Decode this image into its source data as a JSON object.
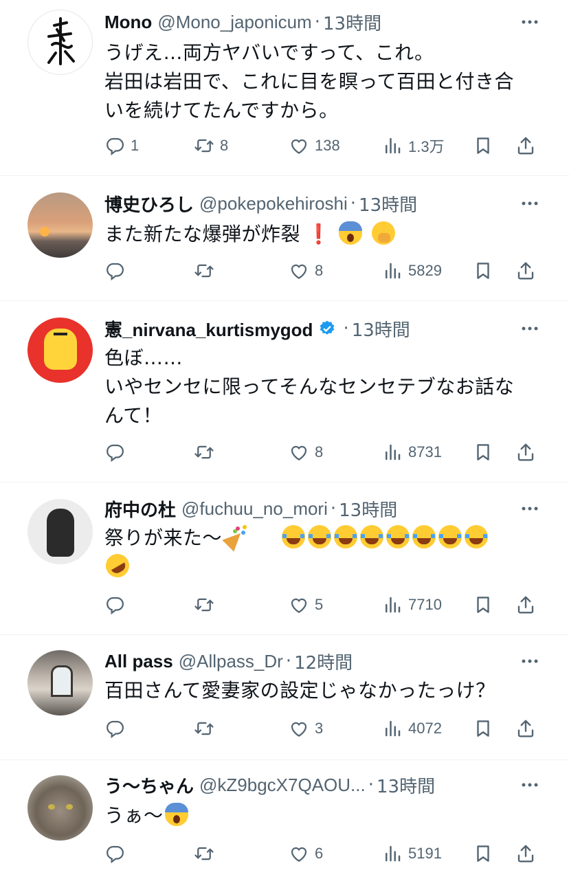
{
  "tweets": [
    {
      "name": "Mono",
      "handle": "@Mono_japonicum",
      "time": "13時間",
      "lines": [
        "うげえ…両方ヤバいですって、これ。",
        "岩田は岩田で、これに目を瞑って百田と付き合",
        "いを続けてたんですから。"
      ],
      "replies": "1",
      "retweets": "8",
      "likes": "138",
      "views": "1.3万",
      "avatar": "brush-calligraphy"
    },
    {
      "name": "博史ひろし",
      "handle": "@pokepokehiroshi",
      "time": "13時間",
      "line1": "また新たな爆弾が炸裂",
      "emoji": [
        "exclamation",
        "fearful-face",
        "face-with-hand-over-mouth"
      ],
      "replies": "",
      "retweets": "",
      "likes": "8",
      "views": "5829",
      "avatar": "sunset-photo"
    },
    {
      "name": "憲_nirvana_kurtismygod",
      "handle": "",
      "verified": true,
      "time": "13時間",
      "lines": [
        "色ぼ……",
        "いやセンセに限ってそんなセンセテブなお話な",
        "んて！"
      ],
      "replies": "",
      "retweets": "",
      "likes": "8",
      "views": "8731",
      "avatar": "tiger-mascot"
    },
    {
      "name": "府中の杜",
      "handle": "@fuchuu_no_mori",
      "time": "13時間",
      "line1": "祭りが来た〜",
      "emoji": [
        "party-popper",
        "face-with-tears-of-joy x8",
        "rolling-on-the-floor-laughing"
      ],
      "replies": "",
      "retweets": "",
      "likes": "5",
      "views": "7710",
      "avatar": "french-bulldog"
    },
    {
      "name": "All pass",
      "handle": "@Allpass_Dr",
      "time": "12時間",
      "lines": [
        "百田さんて愛妻家の設定じゃなかったっけ？"
      ],
      "replies": "",
      "retweets": "",
      "likes": "3",
      "views": "4072",
      "avatar": "interior-room"
    },
    {
      "name": "う〜ちゃん",
      "handle": "@kZ9bgcX7QAOU...",
      "time": "13時間",
      "line1": "うぁ〜",
      "emoji": [
        "face-screaming-in-fear"
      ],
      "replies": "",
      "retweets": "",
      "likes": "6",
      "views": "5191",
      "avatar": "tabby-cat"
    }
  ],
  "sep": "·",
  "icons": [
    "reply-icon",
    "retweet-icon",
    "like-icon",
    "views-icon",
    "bookmark-icon",
    "share-icon",
    "more-icon",
    "verified-badge-icon"
  ],
  "colors": {
    "text": "#0f1419",
    "secondary": "#536471",
    "verified": "#1d9bf0",
    "divider": "#eff3f4"
  }
}
